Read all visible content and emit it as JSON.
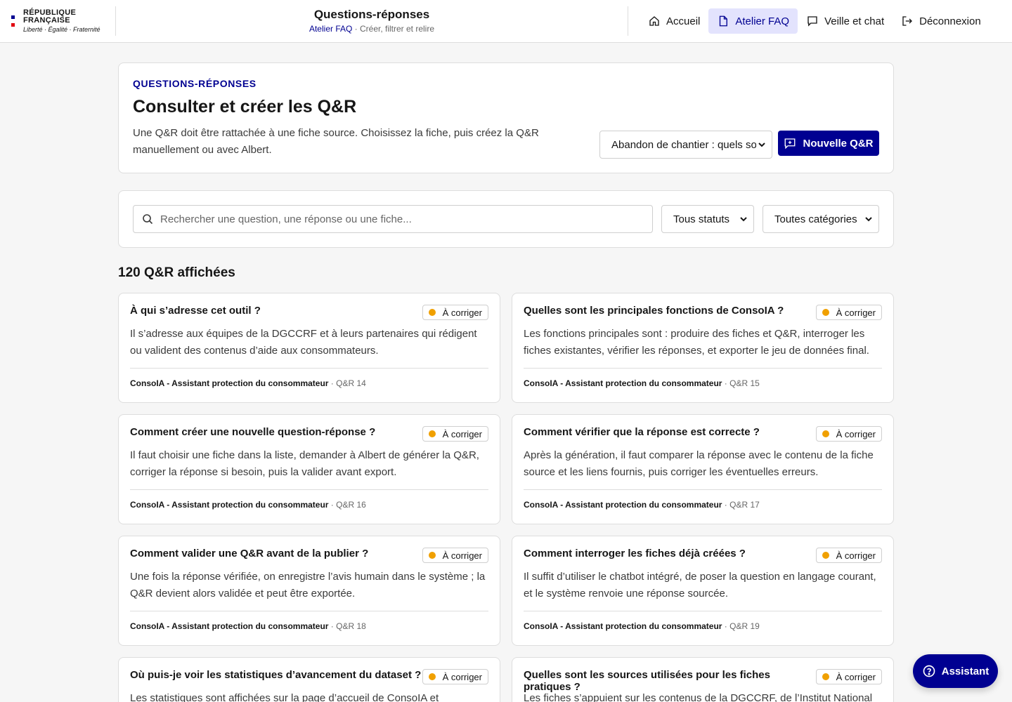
{
  "header": {
    "logo_line1": "RÉPUBLIQUE",
    "logo_line2": "FRANÇAISE",
    "logo_motto": "Liberté · Égalité · Fraternité",
    "app_title": "Questions-réponses",
    "sub_link": "Atelier FAQ",
    "sub_text": " · Créer, filtrer et relire",
    "nav": [
      {
        "label": "Accueil",
        "icon": "home-icon"
      },
      {
        "label": "Atelier FAQ",
        "icon": "document-icon",
        "active": true
      },
      {
        "label": "Veille et chat",
        "icon": "chat-icon"
      },
      {
        "label": "Déconnexion",
        "icon": "logout-icon"
      }
    ]
  },
  "intro": {
    "eyebrow": "QUESTIONS-RÉPONSES",
    "title": "Consulter et créer les Q&R",
    "description": "Une Q&R doit être rattachée à une fiche source. Choisissez la fiche, puis créez la Q&R manuellement ou avec Albert.",
    "fiche_selected": "Abandon de chantier : quels sont",
    "new_button": "Nouvelle Q&R"
  },
  "filters": {
    "search_placeholder": "Rechercher une question, une réponse ou une fiche...",
    "status_selected": "Tous statuts",
    "category_selected": "Toutes catégories"
  },
  "count_label": "120 Q&R affichées",
  "status_color": "#f0a000",
  "items": [
    {
      "question": "À qui s’adresse cet outil ?",
      "status": "À corriger",
      "answer": "Il s’adresse aux équipes de la DGCCRF et à leurs partenaires qui rédigent ou valident des contenus d’aide aux consommateurs.",
      "source": "ConsoIA - Assistant protection du consommateur",
      "ref": " · Q&R 14"
    },
    {
      "question": "Quelles sont les principales fonctions de ConsoIA ?",
      "status": "À corriger",
      "answer": "Les fonctions principales sont : produire des fiches et Q&R, interroger les fiches existantes, vérifier les réponses, et exporter le jeu de données final.",
      "source": "ConsoIA - Assistant protection du consommateur",
      "ref": " · Q&R 15"
    },
    {
      "question": "Comment créer une nouvelle question-réponse ?",
      "status": "À corriger",
      "answer": "Il faut choisir une fiche dans la liste, demander à Albert de générer la Q&R, corriger la réponse si besoin, puis la valider avant export.",
      "source": "ConsoIA - Assistant protection du consommateur",
      "ref": " · Q&R 16"
    },
    {
      "question": "Comment vérifier que la réponse est correcte ?",
      "status": "À corriger",
      "answer": "Après la génération, il faut comparer la réponse avec le contenu de la fiche source et les liens fournis, puis corriger les éventuelles erreurs.",
      "source": "ConsoIA - Assistant protection du consommateur",
      "ref": " · Q&R 17"
    },
    {
      "question": "Comment valider une Q&R avant de la publier ?",
      "status": "À corriger",
      "answer": "Une fois la réponse vérifiée, on enregistre l’avis humain dans le système ; la Q&R devient alors validée et peut être exportée.",
      "source": "ConsoIA - Assistant protection du consommateur",
      "ref": " · Q&R 18"
    },
    {
      "question": "Comment interroger les fiches déjà créées ?",
      "status": "À corriger",
      "answer": "Il suffit d’utiliser le chatbot intégré, de poser la question en langage courant, et le système renvoie une réponse sourcée.",
      "source": "ConsoIA - Assistant protection du consommateur",
      "ref": " · Q&R 19"
    },
    {
      "question": "Où puis-je voir les statistiques d’avancement du dataset ?",
      "status": "À corriger",
      "answer": "Les statistiques sont affichées sur la page d’accueil de ConsoIA et",
      "source": "",
      "ref": ""
    },
    {
      "question": "Quelles sont les sources utilisées pour les fiches pratiques ?",
      "status": "À corriger",
      "answer": "Les fiches s’appuient sur les contenus de la DGCCRF, de l’Institut National",
      "source": "",
      "ref": ""
    }
  ],
  "assistant_label": "Assistant"
}
